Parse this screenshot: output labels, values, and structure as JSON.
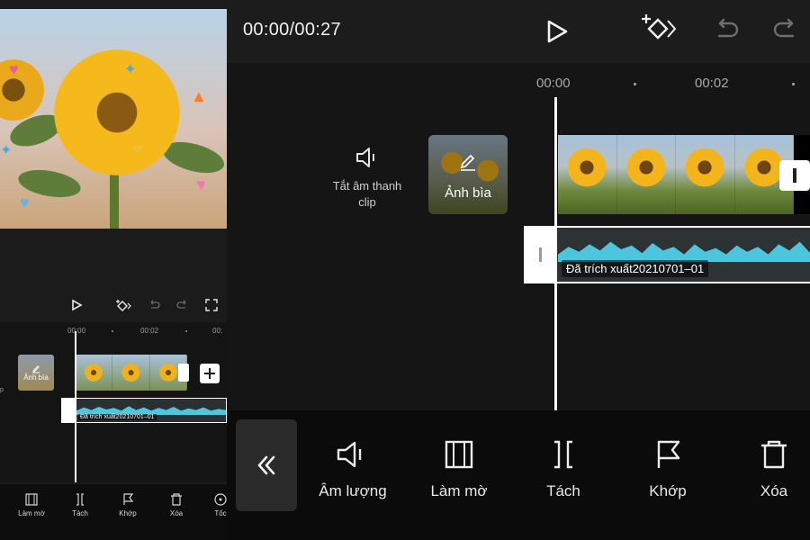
{
  "left_panel": {
    "timeline": {
      "time_marks": [
        "00:00",
        "00:02",
        "00:"
      ],
      "cover_label": "Ảnh bìa",
      "audio_label": "Đã trích xuất20210701–01",
      "mute_label_partial": "p"
    },
    "tools": [
      {
        "label": "Làm mờ",
        "icon": "blur-icon"
      },
      {
        "label": "Tách",
        "icon": "split-icon"
      },
      {
        "label": "Khớp",
        "icon": "flag-icon"
      },
      {
        "label": "Xóa",
        "icon": "delete-icon"
      },
      {
        "label": "Tốc",
        "icon": "speed-icon"
      }
    ]
  },
  "player": {
    "timecode": "00:00/00:27"
  },
  "timeline": {
    "time_marks": [
      "00:00",
      "00:02"
    ],
    "mute_label": "Tắt âm thanh clip",
    "cover_label": "Ảnh bìa",
    "audio_label": "Đã trích xuất20210701–01"
  },
  "toolbar": {
    "back_icon": "double-chevron-left-icon",
    "tools": [
      {
        "label": "Âm lượng",
        "icon": "volume-icon"
      },
      {
        "label": "Làm mờ",
        "icon": "blur-icon"
      },
      {
        "label": "Tách",
        "icon": "split-icon"
      },
      {
        "label": "Khớp",
        "icon": "flag-icon"
      },
      {
        "label": "Xóa",
        "icon": "delete-icon"
      }
    ]
  },
  "colors": {
    "waveform": "#4dc5dc",
    "background": "#1c1c1c",
    "toolbar_bg": "#0b0b0b"
  }
}
